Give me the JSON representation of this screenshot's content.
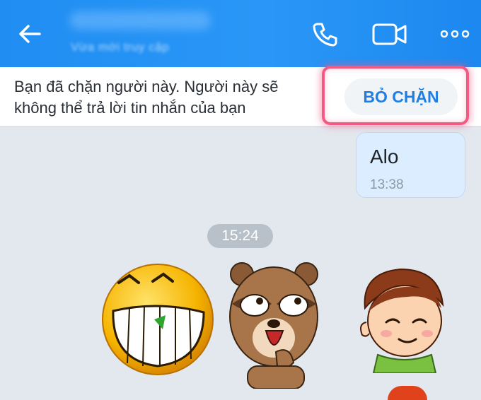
{
  "header": {
    "status_text": "Vừa mới truy cập",
    "back_icon": "arrow-left-icon",
    "call_icon": "phone-icon",
    "video_icon": "video-camera-icon",
    "more_icon": "more-dots-icon",
    "background_color": "#1f8df2"
  },
  "banner": {
    "message_line1": "Bạn đã chặn người này. Người này sẽ",
    "message_line2": "không thể trả lời tin nhắn của bạn",
    "unblock_label": "BỎ CHẶN",
    "highlight_color": "#f25a83"
  },
  "messages": [
    {
      "text": "Alo",
      "time": "13:38",
      "sender": "me"
    }
  ],
  "divider_time": "15:24",
  "stickers": [
    "laughing-smiley-sticker",
    "raccoon-sticker",
    "boy-smiling-sticker"
  ]
}
